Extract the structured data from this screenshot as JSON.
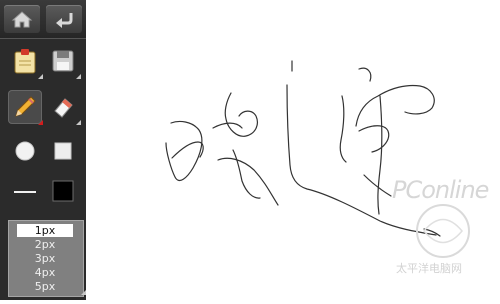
{
  "toolbar": {
    "top_buttons": [
      {
        "name": "home-icon"
      },
      {
        "name": "undo-icon"
      }
    ],
    "tools": [
      {
        "name": "clipboard-icon"
      },
      {
        "name": "save-disk-icon"
      },
      {
        "name": "pencil-icon",
        "active": true
      },
      {
        "name": "eraser-icon"
      },
      {
        "name": "round-brush-icon"
      },
      {
        "name": "square-brush-icon"
      },
      {
        "name": "line-style-icon"
      },
      {
        "name": "color-swatch-icon",
        "color": "#000000"
      }
    ],
    "sizes": [
      "1px",
      "2px",
      "3px",
      "4px",
      "5px"
    ],
    "selected_size": "1px"
  },
  "watermark": {
    "brand": "PConline",
    "sub": "太平洋电脑网"
  }
}
